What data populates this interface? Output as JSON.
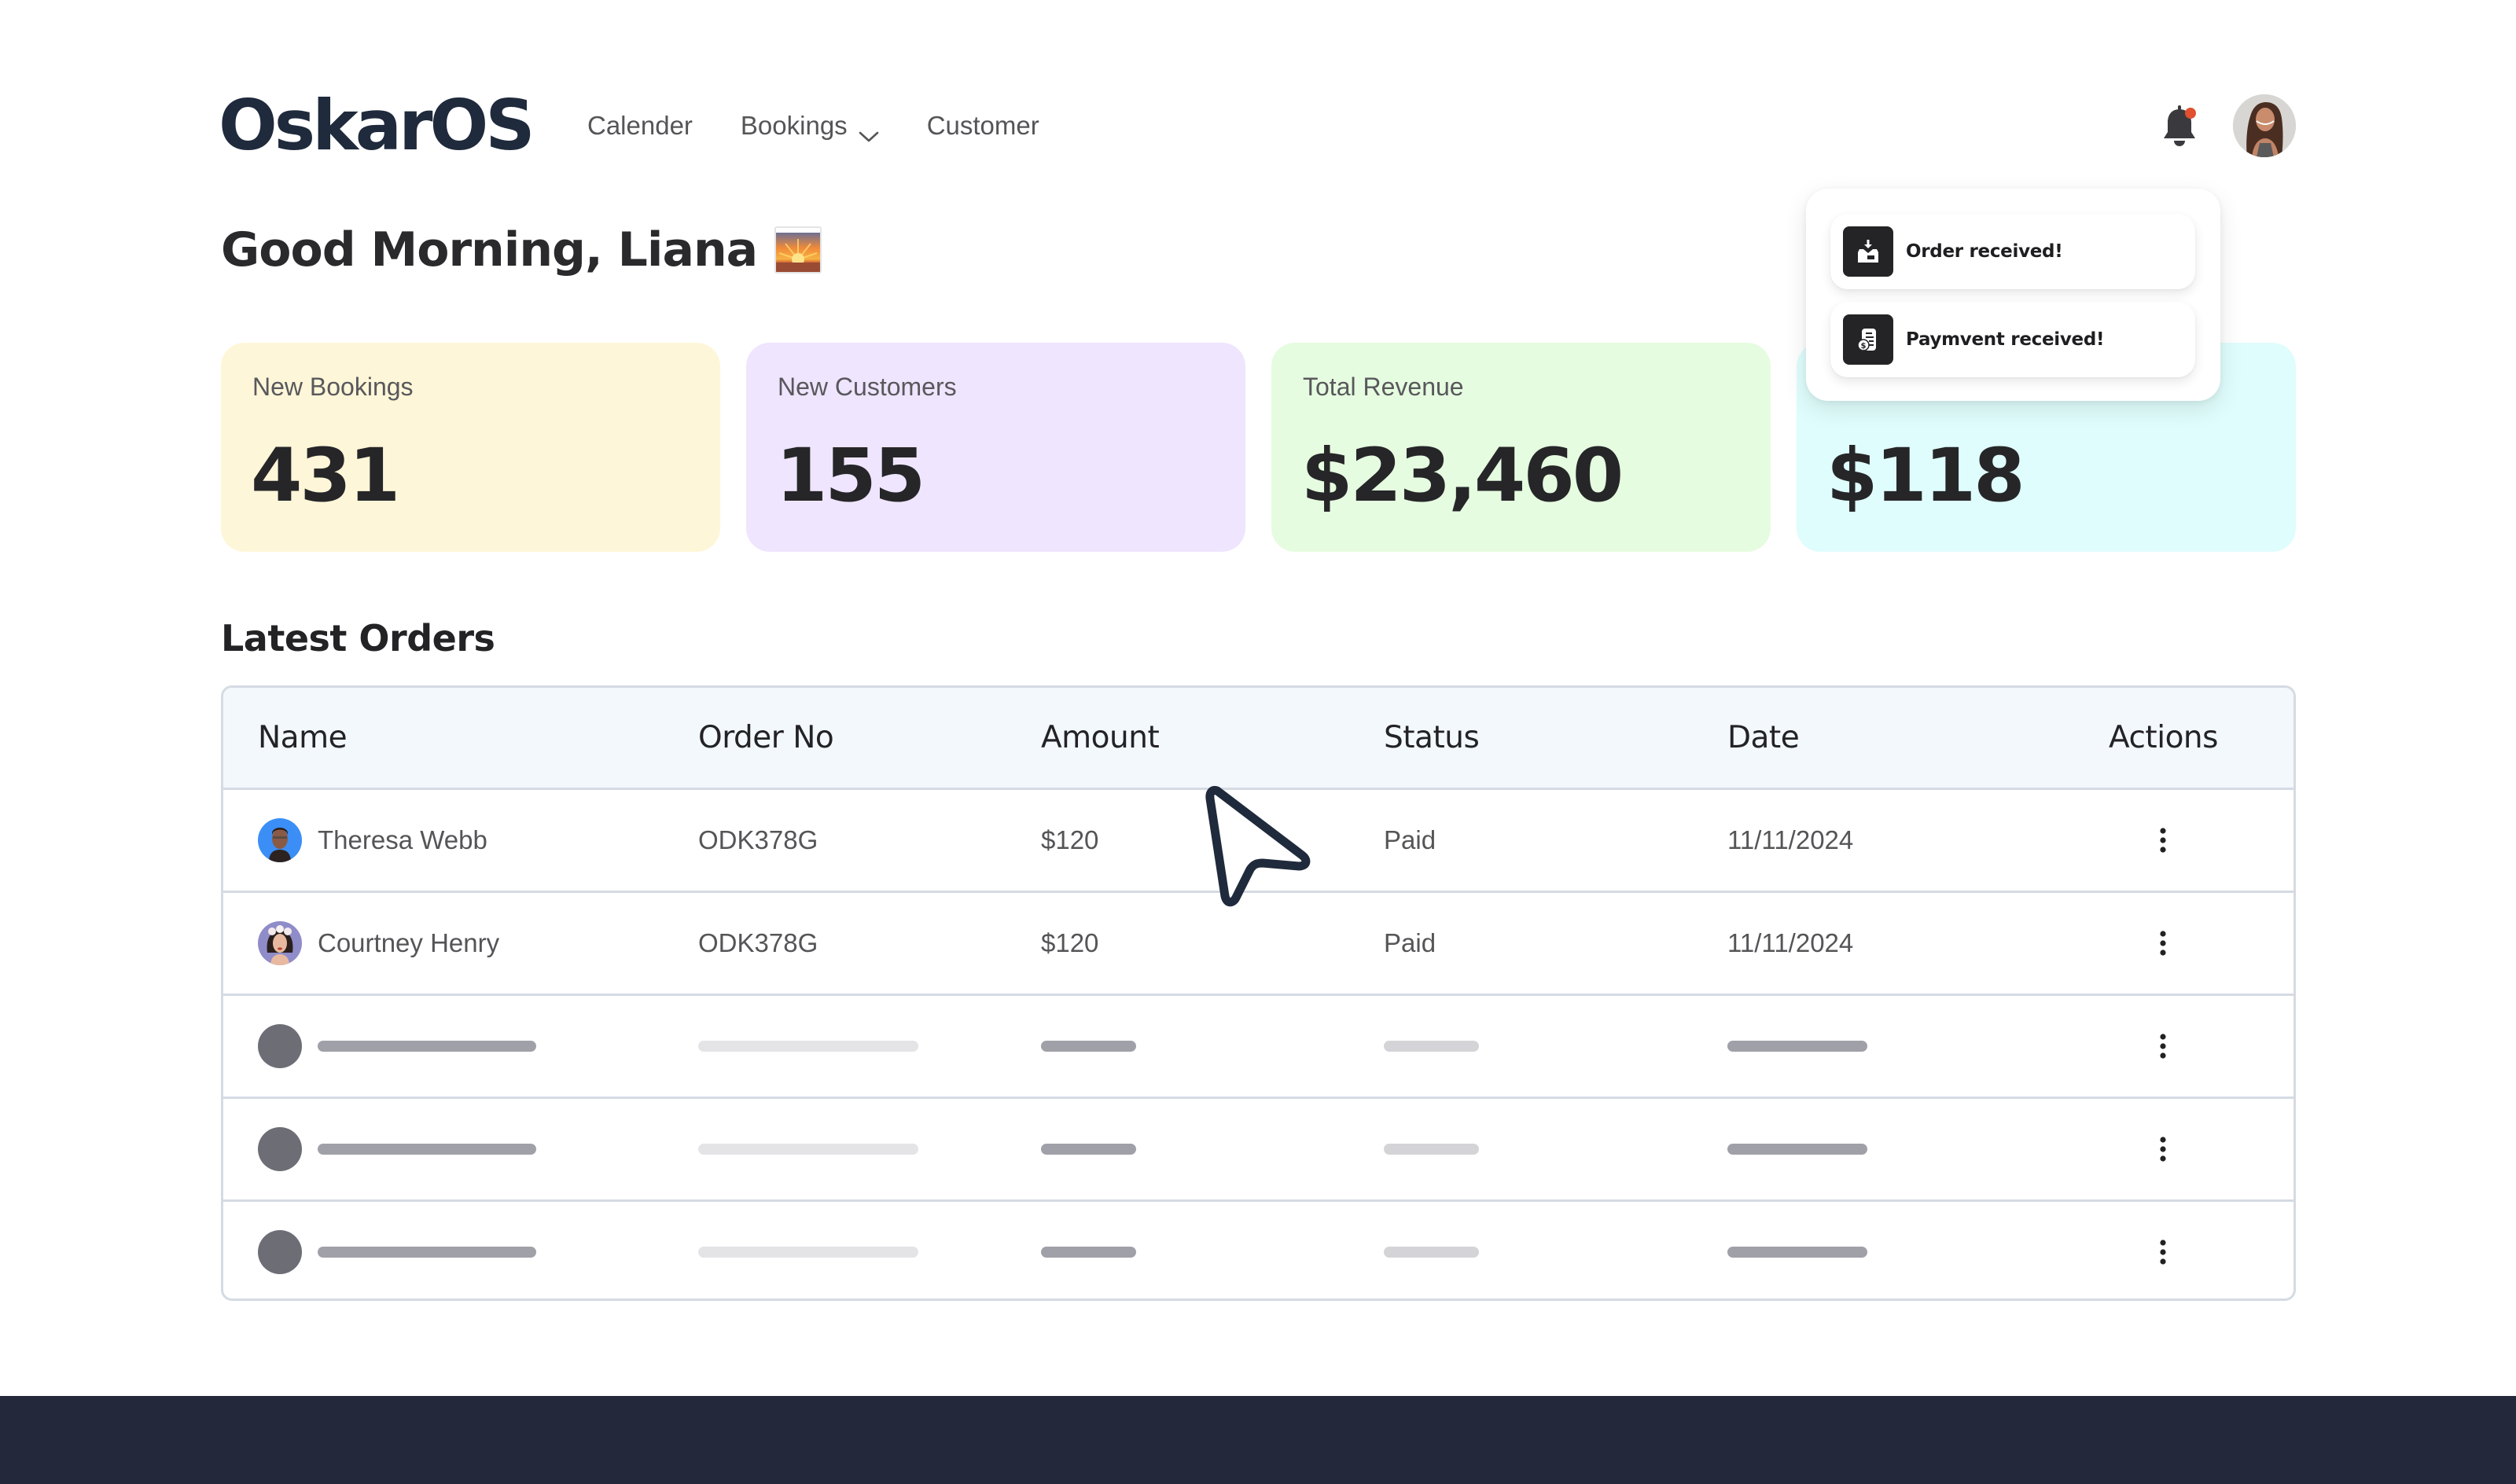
{
  "app": {
    "logo_text": "OskarOS"
  },
  "nav": {
    "items": [
      {
        "label": "Calender",
        "has_dropdown": false
      },
      {
        "label": "Bookings",
        "has_dropdown": true
      },
      {
        "label": "Customer",
        "has_dropdown": false
      }
    ]
  },
  "header": {
    "notifications_icon": "bell-icon",
    "has_unread_notifications": true,
    "unread_dot_color": "#e0502f",
    "user_avatar": "user-avatar"
  },
  "greeting": {
    "text": "Good Morning, Liana",
    "emoji": "🌅"
  },
  "stats": [
    {
      "label": "New Bookings",
      "value": "431",
      "bg": "#fef6d8"
    },
    {
      "label": "New Customers",
      "value": "155",
      "bg": "#efe5fe"
    },
    {
      "label": "Total Revenue",
      "value": "$23,460",
      "bg": "#e6fce0"
    },
    {
      "label": "",
      "value": "$118",
      "bg": "#dffdfc"
    }
  ],
  "notifications": [
    {
      "icon": "inbox-download-icon",
      "text": "Order received!"
    },
    {
      "icon": "payment-receipt-icon",
      "text": "Paymvent received!"
    }
  ],
  "orders": {
    "title": "Latest Orders",
    "columns": [
      "Name",
      "Order No",
      "Amount",
      "Status",
      "Date",
      "Actions"
    ],
    "rows": [
      {
        "name": "Theresa Webb",
        "order_no": "ODK378G",
        "amount": "$120",
        "status": "Paid",
        "date": "11/11/2024",
        "avatar_bg": "#3b8ef5"
      },
      {
        "name": "Courtney Henry",
        "order_no": "ODK378G",
        "amount": "$120",
        "status": "Paid",
        "date": "11/11/2024",
        "avatar_bg": "#8f8cc9"
      }
    ],
    "loading_rows": 3
  },
  "colors": {
    "brand_dark": "#1f2a3c",
    "footer": "#23293b",
    "table_header_bg": "#f3f8fd",
    "table_border": "#d5dbe3"
  }
}
